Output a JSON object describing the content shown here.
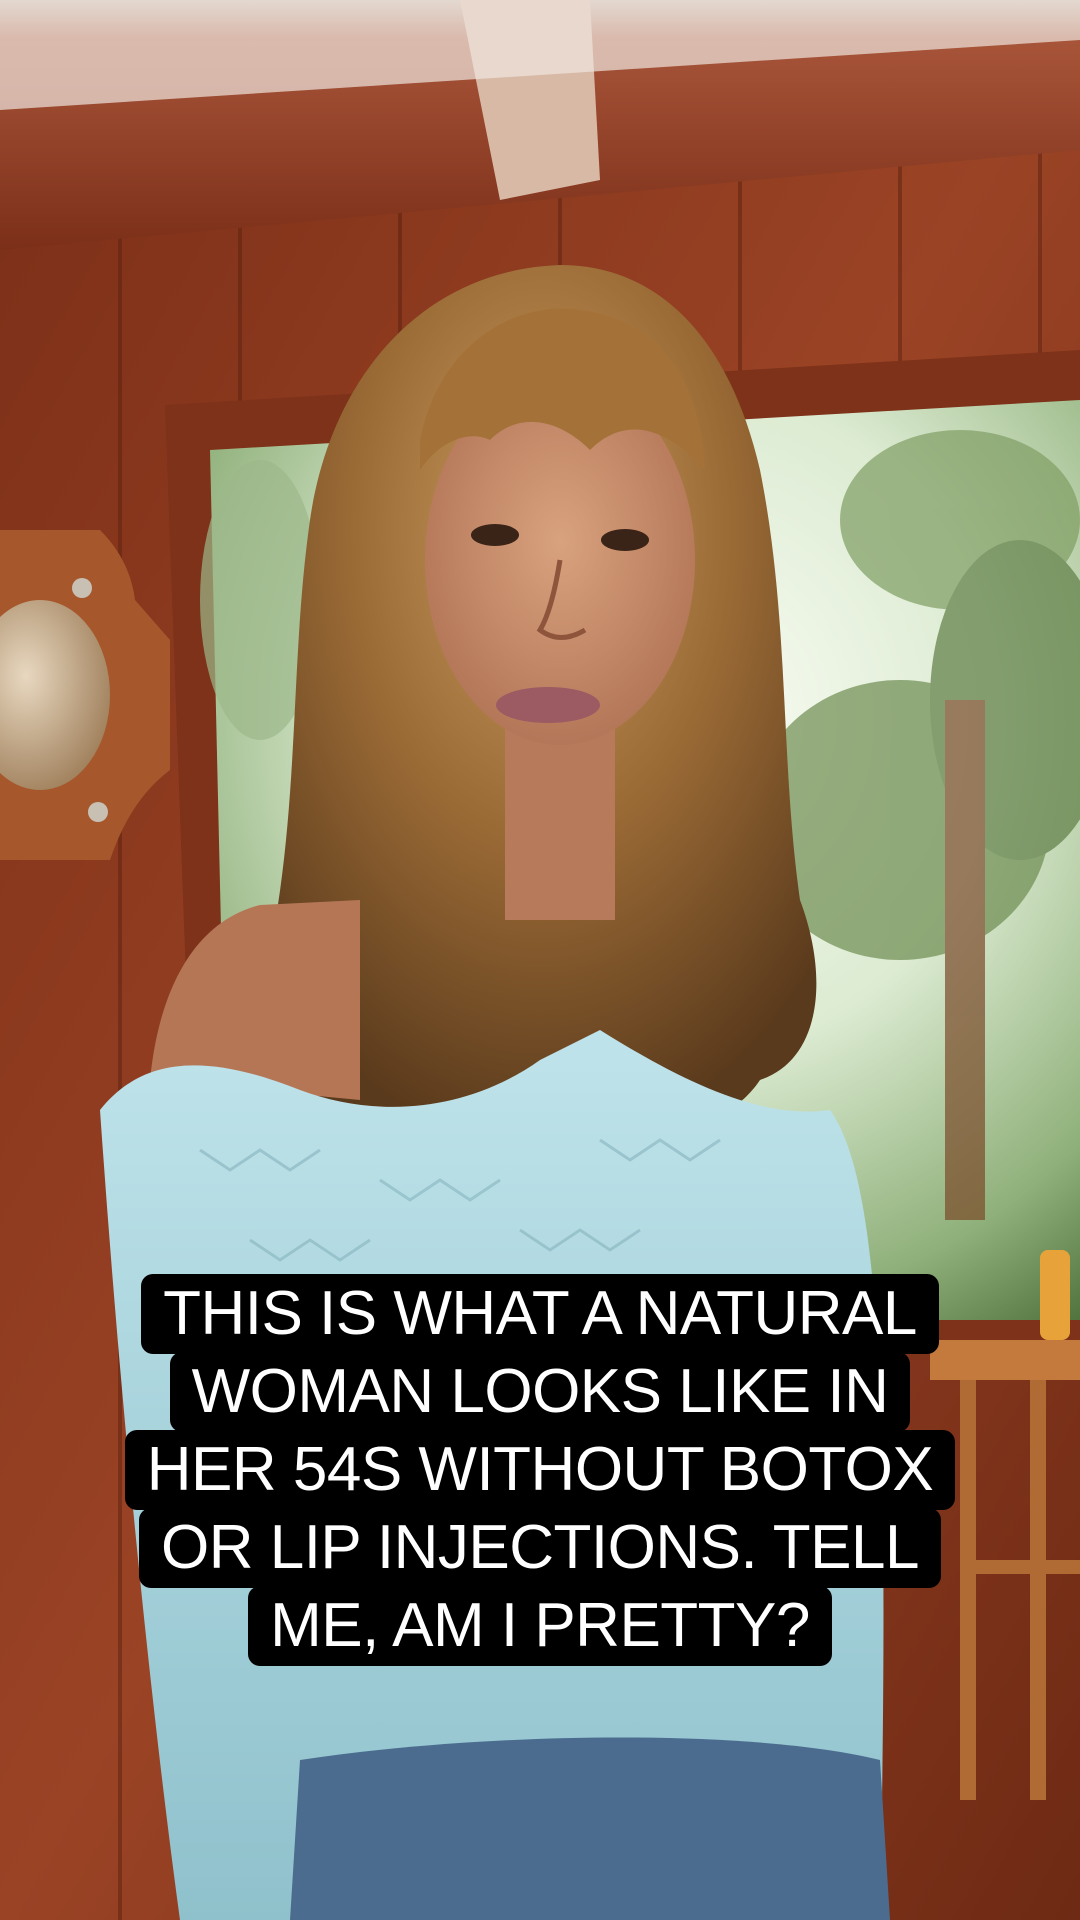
{
  "caption": {
    "lines": [
      "THIS IS WHAT A NATURAL",
      "WOMAN LOOKS LIKE IN",
      "HER 54S WITHOUT BOTOX",
      "OR LIP INJECTIONS. TELL",
      "ME, AM I PRETTY?"
    ],
    "text_color": "#ffffff",
    "background_color": "#000000"
  },
  "scene": {
    "wall_color": "#8a3a1f",
    "ceiling_color": "#b0583a",
    "window_light_color": "#e9f3e4",
    "sweater_color": "#a9d4dc",
    "hair_color": "#8a5a2e"
  }
}
